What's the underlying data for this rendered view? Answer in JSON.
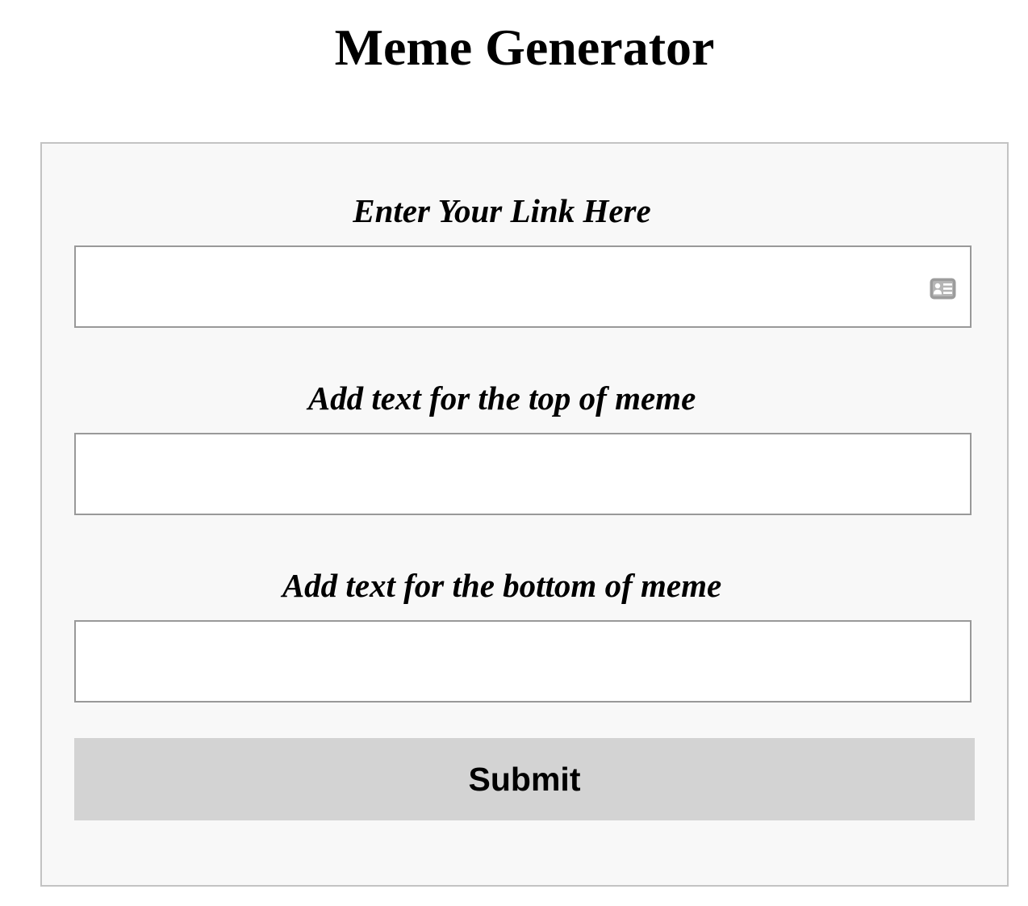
{
  "page": {
    "title": "Meme Generator"
  },
  "form": {
    "link_field": {
      "label": "Enter Your Link Here",
      "value": "",
      "placeholder": "",
      "autofill_icon": "contact-card-icon"
    },
    "top_text_field": {
      "label": "Add text for the top of meme",
      "value": "",
      "placeholder": ""
    },
    "bottom_text_field": {
      "label": "Add text for the bottom of meme",
      "value": "",
      "placeholder": ""
    },
    "submit_label": "Submit"
  },
  "colors": {
    "panel_background": "#f8f8f8",
    "panel_border": "#c3c3c3",
    "input_border": "#999999",
    "button_background": "#d3d3d3",
    "icon_color": "#9c9c9c"
  }
}
